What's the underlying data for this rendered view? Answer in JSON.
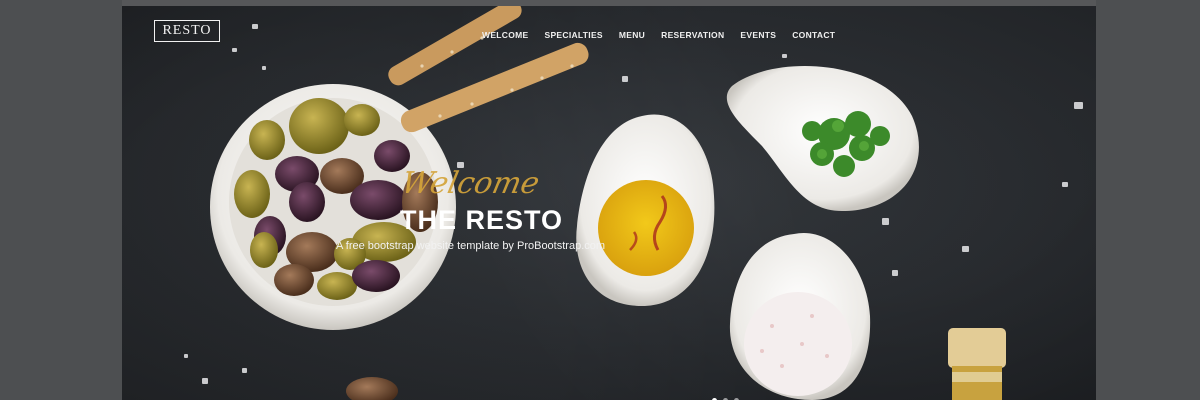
{
  "brand": {
    "logo": "RESTO"
  },
  "nav": {
    "items": [
      {
        "label": "WELCOME",
        "name": "nav-welcome"
      },
      {
        "label": "SPECIALTIES",
        "name": "nav-specialties"
      },
      {
        "label": "MENU",
        "name": "nav-menu"
      },
      {
        "label": "RESERVATION",
        "name": "nav-reservation"
      },
      {
        "label": "EVENTS",
        "name": "nav-events"
      },
      {
        "label": "CONTACT",
        "name": "nav-contact"
      }
    ]
  },
  "hero": {
    "script_text": "Welcome",
    "title": "THE RESTO",
    "subtitle": "A free bootstrap website template by ProBootstrap.com"
  },
  "colors": {
    "background": "#202327",
    "accent_gold": "#d4a43a",
    "text": "#ffffff"
  }
}
